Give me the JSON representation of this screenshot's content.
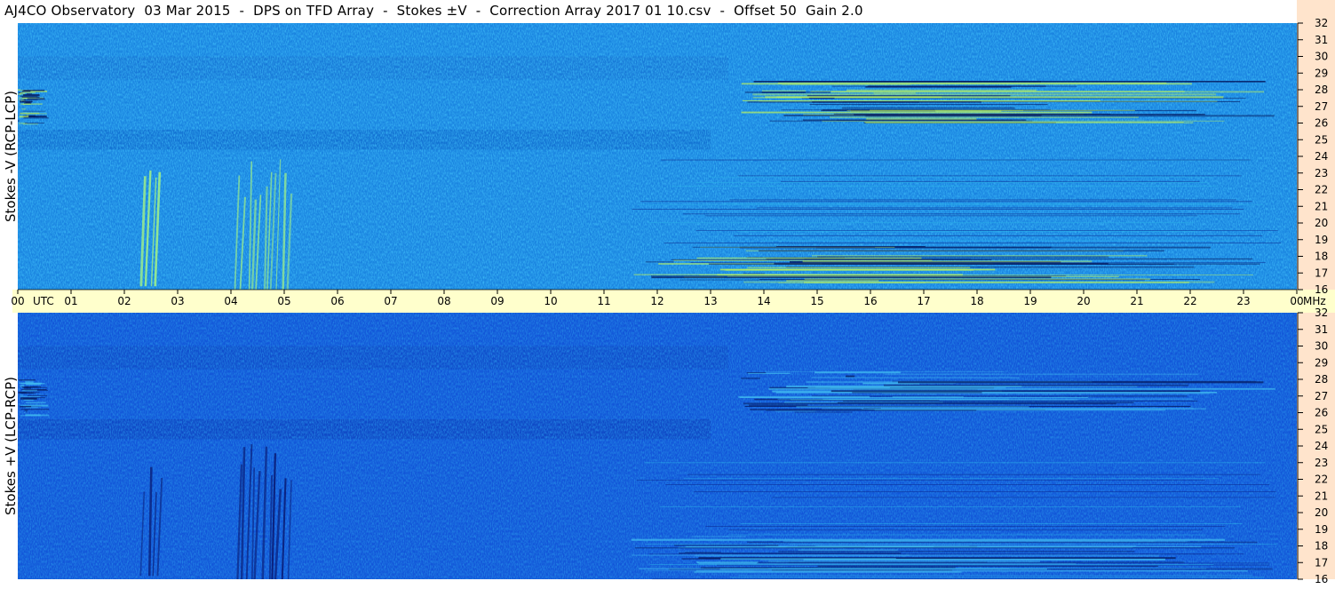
{
  "title": "AJ4CO Observatory  03 Mar 2015  -  DPS on TFD Array  -  Stokes ±V  -  Correction Array 2017 01 10.csv  -  Offset 50  Gain 2.0",
  "colors": {
    "time_axis_band": "#ffffcc",
    "freq_axis_band": "#ffe4cc",
    "top_background": "#1a84e0",
    "bottom_background": "#1256d8",
    "burst_top": "#9ef08a",
    "burst_bottom": "#0a1f7a",
    "rfi_bright": "#b8f060",
    "rfi_dark": "#041a60"
  },
  "chart_data": [
    {
      "type": "heatmap",
      "panel": "top",
      "ylabel": "Stokes -V (RCP-LCP)",
      "y_unit": "MHz",
      "ylim": [
        16,
        32
      ],
      "y_ticks": [
        "16",
        "17",
        "18",
        "19",
        "20",
        "21",
        "22",
        "23",
        "24",
        "25",
        "26",
        "27",
        "28",
        "29",
        "30",
        "31",
        "32"
      ],
      "xlim": [
        0,
        24
      ],
      "x_unit": "UTC",
      "x_ticks": [
        "00",
        "01",
        "02",
        "03",
        "04",
        "05",
        "06",
        "07",
        "08",
        "09",
        "10",
        "11",
        "12",
        "13",
        "14",
        "15",
        "16",
        "17",
        "18",
        "19",
        "20",
        "21",
        "22",
        "23",
        "00"
      ],
      "features": [
        {
          "kind": "burst",
          "t_start": 2.35,
          "t_end": 2.75,
          "f_low": 16.2,
          "f_high": 23.6
        },
        {
          "kind": "burst",
          "t_start": 4.15,
          "t_end": 5.2,
          "f_low": 16.0,
          "f_high": 24.2
        },
        {
          "kind": "rfi_band",
          "t_start": 13.5,
          "t_end": 23.6,
          "f_low": 26.0,
          "f_high": 28.5
        },
        {
          "kind": "rfi_band",
          "t_start": 11.5,
          "t_end": 23.6,
          "f_low": 16.4,
          "f_high": 18.6
        },
        {
          "kind": "rfi_band",
          "t_start": 0.0,
          "t_end": 0.6,
          "f_low": 25.8,
          "f_high": 28.0
        }
      ]
    },
    {
      "type": "heatmap",
      "panel": "bottom",
      "ylabel": "Stokes +V (LCP-RCP)",
      "y_unit": "MHz",
      "ylim": [
        16,
        32
      ],
      "y_ticks": [
        "16",
        "17",
        "18",
        "19",
        "20",
        "21",
        "22",
        "23",
        "24",
        "25",
        "26",
        "27",
        "28",
        "29",
        "30",
        "31",
        "32"
      ],
      "xlim": [
        0,
        24
      ],
      "x_ticks": [
        "00",
        "01",
        "02",
        "03",
        "04",
        "05",
        "06",
        "07",
        "08",
        "09",
        "10",
        "11",
        "12",
        "13",
        "14",
        "15",
        "16",
        "17",
        "18",
        "19",
        "20",
        "21",
        "22",
        "23",
        "00"
      ],
      "features": [
        {
          "kind": "burst",
          "t_start": 2.35,
          "t_end": 2.75,
          "f_low": 16.2,
          "f_high": 23.6
        },
        {
          "kind": "burst",
          "t_start": 4.15,
          "t_end": 5.2,
          "f_low": 16.0,
          "f_high": 24.2
        },
        {
          "kind": "rfi_band",
          "t_start": 13.5,
          "t_end": 23.6,
          "f_low": 26.0,
          "f_high": 28.5
        },
        {
          "kind": "rfi_band",
          "t_start": 11.5,
          "t_end": 23.6,
          "f_low": 16.4,
          "f_high": 18.6
        },
        {
          "kind": "rfi_band",
          "t_start": 0.0,
          "t_end": 0.6,
          "f_low": 25.8,
          "f_high": 28.0
        }
      ]
    }
  ]
}
